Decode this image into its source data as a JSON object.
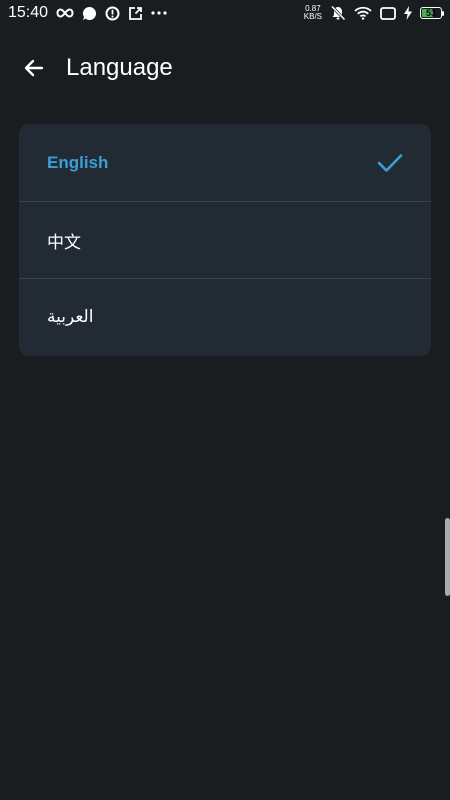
{
  "status_bar": {
    "time": "15:40",
    "net_speed_value": "0.87",
    "net_speed_unit": "KB/S",
    "battery_level": "53",
    "icons": [
      "infinity-icon",
      "message-icon",
      "alert-icon",
      "share-icon",
      "more-dots-icon",
      "bell-off-icon",
      "wifi-icon",
      "screen-icon",
      "charging-icon",
      "battery-icon"
    ]
  },
  "header": {
    "title": "Language"
  },
  "languages": [
    {
      "label": "English",
      "selected": true
    },
    {
      "label": "中文",
      "selected": false
    },
    {
      "label": "العربية",
      "selected": false
    }
  ],
  "colors": {
    "background": "#1a1d20",
    "card": "#222a33",
    "accent": "#3aa0d6",
    "battery": "#4caf50"
  }
}
